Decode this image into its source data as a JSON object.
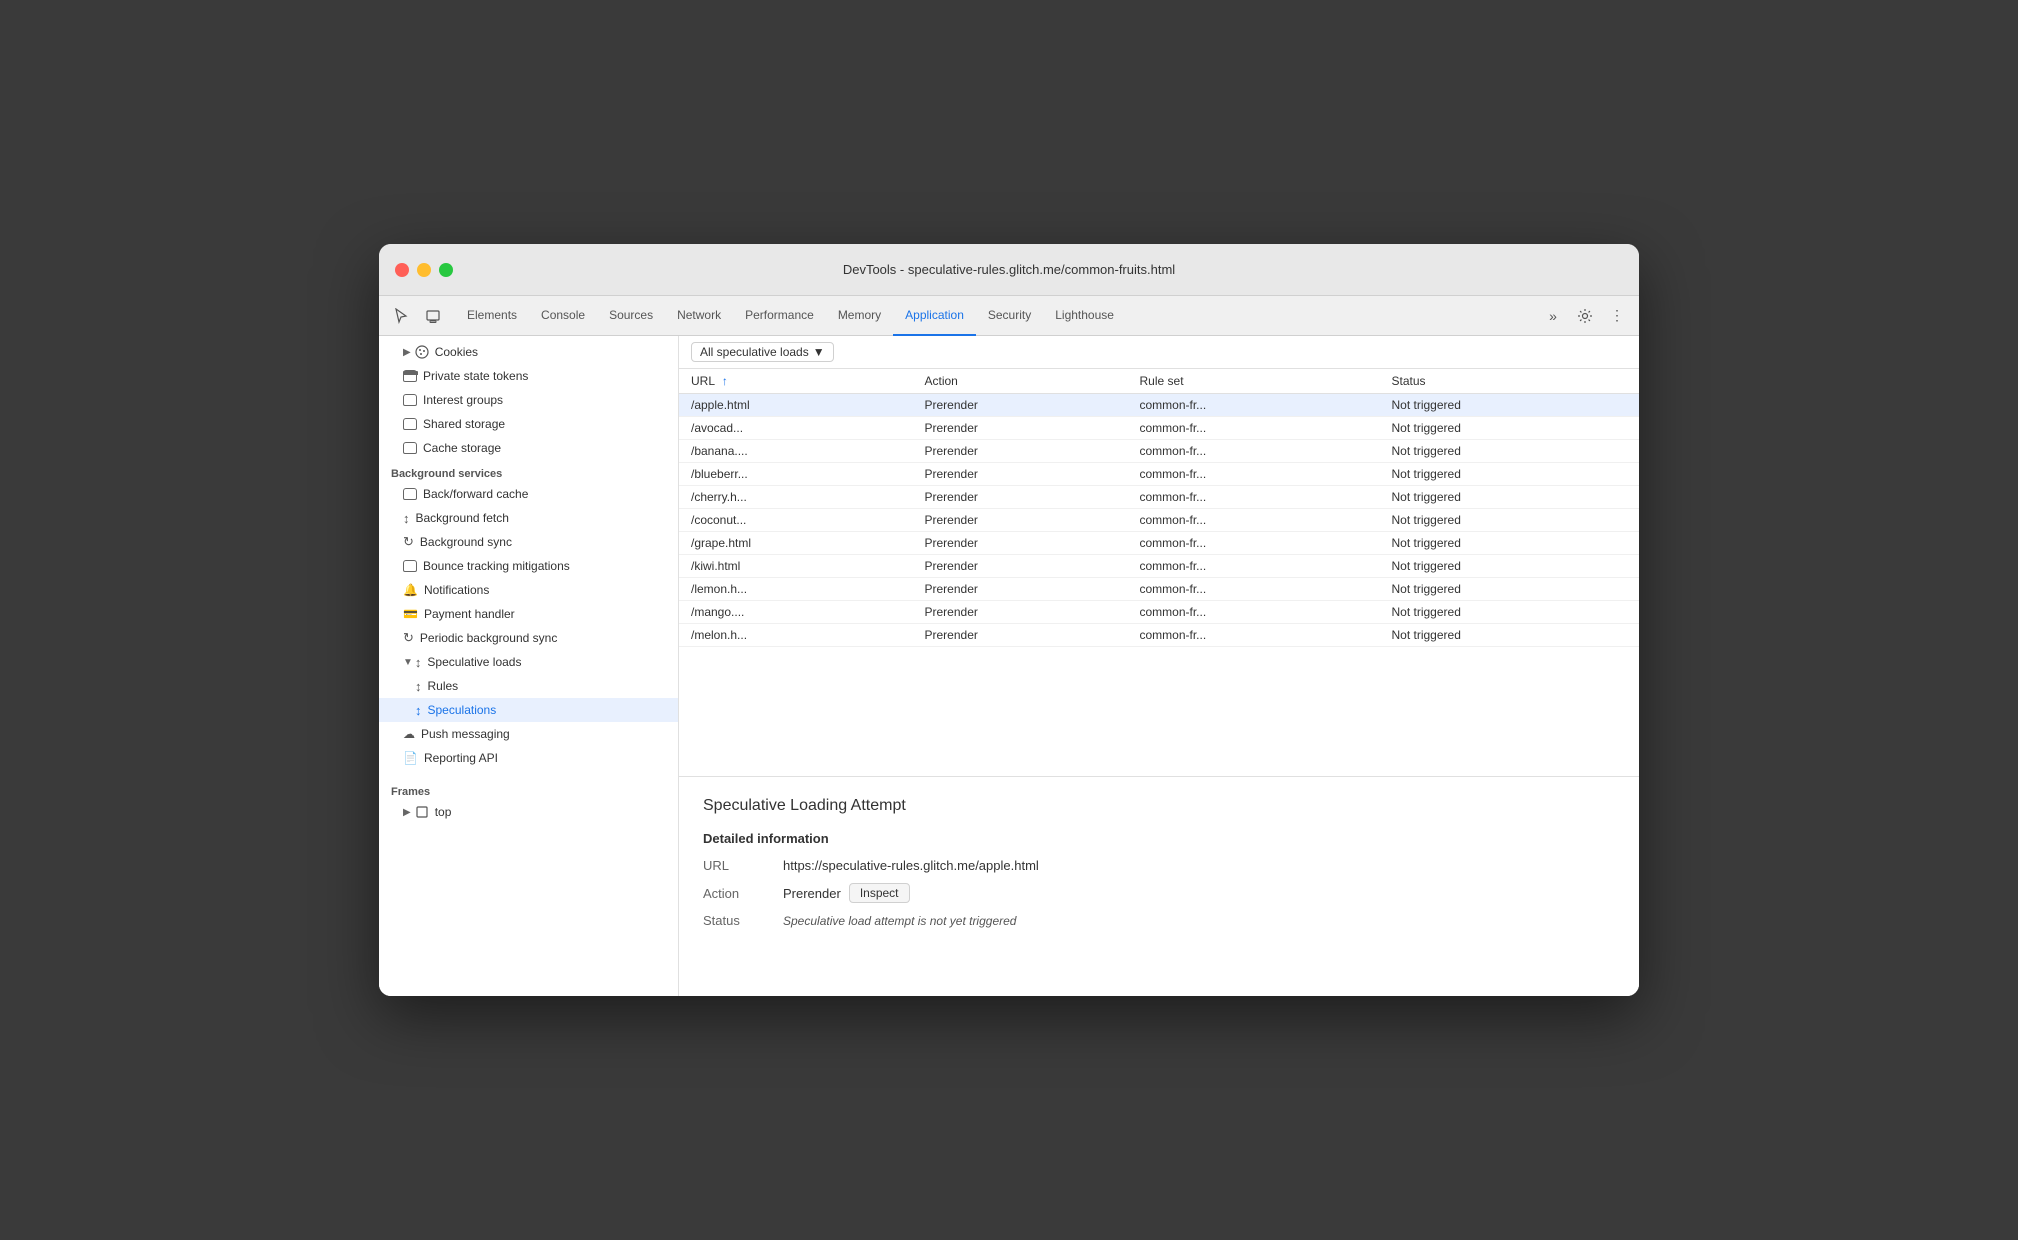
{
  "window": {
    "title": "DevTools - speculative-rules.glitch.me/common-fruits.html"
  },
  "tabs": {
    "items": [
      {
        "label": "Elements",
        "active": false
      },
      {
        "label": "Console",
        "active": false
      },
      {
        "label": "Sources",
        "active": false
      },
      {
        "label": "Network",
        "active": false
      },
      {
        "label": "Performance",
        "active": false
      },
      {
        "label": "Memory",
        "active": false
      },
      {
        "label": "Application",
        "active": true
      },
      {
        "label": "Security",
        "active": false
      },
      {
        "label": "Lighthouse",
        "active": false
      }
    ]
  },
  "sidebar": {
    "storage_items": [
      {
        "label": "Cookies",
        "indent": 1,
        "icon": "▶",
        "hasArrow": true
      },
      {
        "label": "Private state tokens",
        "indent": 1,
        "icon": "db"
      },
      {
        "label": "Interest groups",
        "indent": 1,
        "icon": "db"
      },
      {
        "label": "Shared storage",
        "indent": 1,
        "icon": "db",
        "hasExpand": true
      },
      {
        "label": "Cache storage",
        "indent": 1,
        "icon": "db"
      }
    ],
    "background_services_header": "Background services",
    "background_services": [
      {
        "label": "Back/forward cache",
        "indent": 1,
        "icon": "db"
      },
      {
        "label": "Background fetch",
        "indent": 1,
        "icon": "↕"
      },
      {
        "label": "Background sync",
        "indent": 1,
        "icon": "↻"
      },
      {
        "label": "Bounce tracking mitigations",
        "indent": 1,
        "icon": "db"
      },
      {
        "label": "Notifications",
        "indent": 1,
        "icon": "🔔"
      },
      {
        "label": "Payment handler",
        "indent": 1,
        "icon": "💳"
      },
      {
        "label": "Periodic background sync",
        "indent": 1,
        "icon": "↻"
      },
      {
        "label": "Speculative loads",
        "indent": 1,
        "icon": "↕",
        "expanded": true
      },
      {
        "label": "Rules",
        "indent": 2,
        "icon": "↕"
      },
      {
        "label": "Speculations",
        "indent": 2,
        "icon": "↕",
        "selected": true
      }
    ],
    "other_services": [
      {
        "label": "Push messaging",
        "indent": 1,
        "icon": "☁"
      },
      {
        "label": "Reporting API",
        "indent": 1,
        "icon": "📄"
      }
    ],
    "frames_header": "Frames",
    "frames": [
      {
        "label": "top",
        "indent": 1,
        "hasArrow": true
      }
    ]
  },
  "filter": {
    "label": "All speculative loads",
    "dropdown_icon": "▼"
  },
  "table": {
    "columns": [
      {
        "label": "URL",
        "sortable": true
      },
      {
        "label": "Action",
        "sortable": false
      },
      {
        "label": "Rule set",
        "sortable": false
      },
      {
        "label": "Status",
        "sortable": false
      }
    ],
    "rows": [
      {
        "url": "/apple.html",
        "action": "Prerender",
        "ruleset": "common-fr...",
        "status": "Not triggered",
        "selected": true
      },
      {
        "url": "/avocad...",
        "action": "Prerender",
        "ruleset": "common-fr...",
        "status": "Not triggered"
      },
      {
        "url": "/banana....",
        "action": "Prerender",
        "ruleset": "common-fr...",
        "status": "Not triggered"
      },
      {
        "url": "/blueberr...",
        "action": "Prerender",
        "ruleset": "common-fr...",
        "status": "Not triggered"
      },
      {
        "url": "/cherry.h...",
        "action": "Prerender",
        "ruleset": "common-fr...",
        "status": "Not triggered"
      },
      {
        "url": "/coconut...",
        "action": "Prerender",
        "ruleset": "common-fr...",
        "status": "Not triggered"
      },
      {
        "url": "/grape.html",
        "action": "Prerender",
        "ruleset": "common-fr...",
        "status": "Not triggered"
      },
      {
        "url": "/kiwi.html",
        "action": "Prerender",
        "ruleset": "common-fr...",
        "status": "Not triggered"
      },
      {
        "url": "/lemon.h...",
        "action": "Prerender",
        "ruleset": "common-fr...",
        "status": "Not triggered"
      },
      {
        "url": "/mango....",
        "action": "Prerender",
        "ruleset": "common-fr...",
        "status": "Not triggered"
      },
      {
        "url": "/melon.h...",
        "action": "Prerender",
        "ruleset": "common-fr...",
        "status": "Not triggered"
      }
    ]
  },
  "detail": {
    "title": "Speculative Loading Attempt",
    "section_title": "Detailed information",
    "url_label": "URL",
    "url_value": "https://speculative-rules.glitch.me/apple.html",
    "action_label": "Action",
    "action_value": "Prerender",
    "inspect_button": "Inspect",
    "status_label": "Status",
    "status_value": "Speculative load attempt is not yet triggered"
  }
}
